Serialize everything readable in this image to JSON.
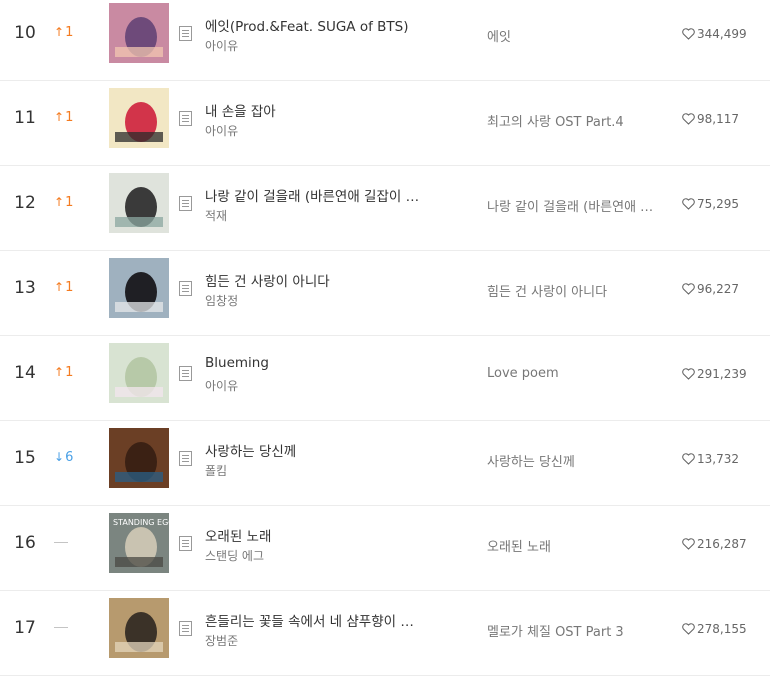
{
  "chart": {
    "rows": [
      {
        "rank": "10",
        "change_dir": "up",
        "change": "1",
        "title": "에잇(Prod.&Feat. SUGA of BTS)",
        "artist": "아이유",
        "album": "에잇",
        "likes": "344,499",
        "art_icon": "album-art-eight",
        "art_colors": [
          "#c98aa2",
          "#6e4a7a",
          "#f1c6b0"
        ]
      },
      {
        "rank": "11",
        "change_dir": "up",
        "change": "1",
        "title": "내 손을 잡아",
        "artist": "아이유",
        "album": "최고의 사랑 OST Part.4",
        "likes": "98,117",
        "art_icon": "album-art-best-love",
        "art_colors": [
          "#f2e7c4",
          "#d2344a",
          "#2b2b2b"
        ]
      },
      {
        "rank": "12",
        "change_dir": "up",
        "change": "1",
        "title": "나랑 같이 걸을래 (바른연애 길잡이 X 적재)",
        "artist": "적재",
        "album": "나랑 같이 걸을래 (바른연애 길잡이 X 적재)",
        "likes": "75,295",
        "art_icon": "album-art-walk-with-me",
        "art_colors": [
          "#dfe3dc",
          "#3a3a3a",
          "#8ba7a0"
        ]
      },
      {
        "rank": "13",
        "change_dir": "up",
        "change": "1",
        "title": "힘든 건 사랑이 아니다",
        "artist": "임창정",
        "album": "힘든 건 사랑이 아니다",
        "likes": "96,227",
        "art_icon": "album-art-hard-love",
        "art_colors": [
          "#9fb1bf",
          "#1f1f24",
          "#e6e8ea"
        ]
      },
      {
        "rank": "14",
        "change_dir": "up",
        "change": "1",
        "title": "Blueming",
        "artist": "아이유",
        "album": "Love poem",
        "likes": "291,239",
        "art_icon": "album-art-love-poem",
        "art_colors": [
          "#d8e3d2",
          "#b7c9a8",
          "#f3e6ee"
        ]
      },
      {
        "rank": "15",
        "change_dir": "down",
        "change": "6",
        "title": "사랑하는 당신께",
        "artist": "폴킴",
        "album": "사랑하는 당신께",
        "likes": "13,732",
        "art_icon": "album-art-dear-love",
        "art_colors": [
          "#6b3f25",
          "#3b2114",
          "#2a5f86"
        ]
      },
      {
        "rank": "16",
        "change_dir": "none",
        "change": "",
        "title": "오래된 노래",
        "artist": "스탠딩 에그",
        "album": "오래된 노래",
        "likes": "216,287",
        "art_icon": "album-art-old-song",
        "art_colors": [
          "#7b8580",
          "#c9c3b1",
          "#4a4a44"
        ],
        "art_text": "STANDING EGG"
      },
      {
        "rank": "17",
        "change_dir": "none",
        "change": "",
        "title": "흔들리는 꽃들 속에서 네 샴푸향이 느껴진거야",
        "artist": "장범준",
        "album": "멜로가 체질 OST Part 3",
        "likes": "278,155",
        "art_icon": "album-art-melo",
        "art_colors": [
          "#b79a6e",
          "#3b3228",
          "#e4d6bc"
        ]
      }
    ]
  }
}
